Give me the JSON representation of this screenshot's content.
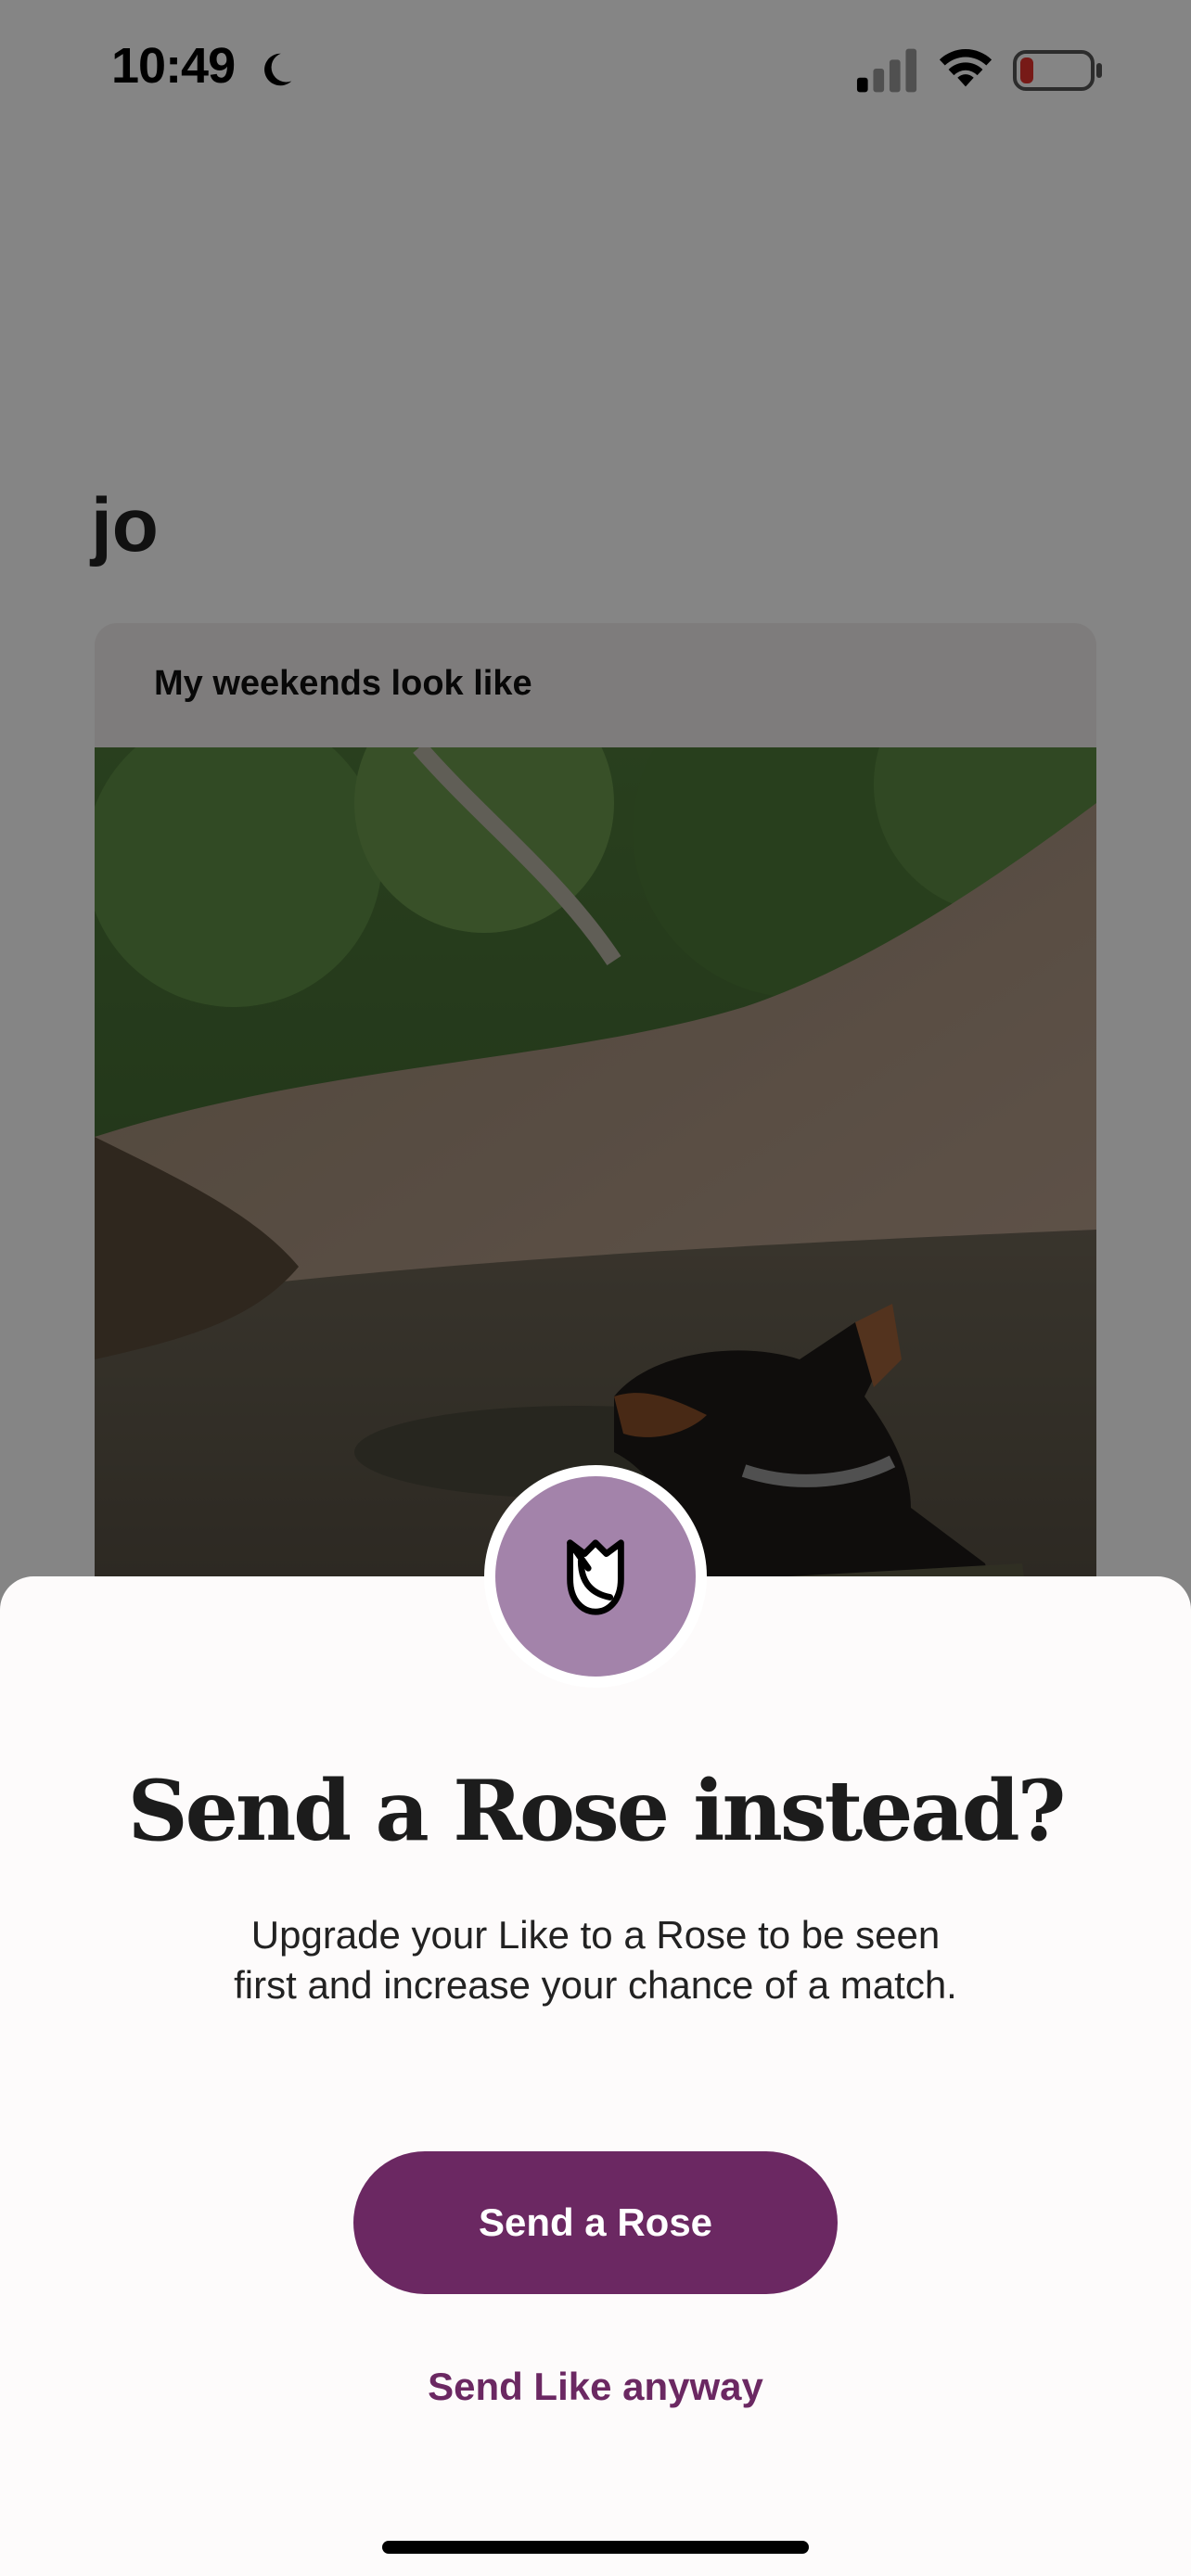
{
  "status_bar": {
    "time": "10:49",
    "icons": [
      "moon-icon",
      "cellular-signal-icon",
      "wifi-icon",
      "battery-icon"
    ],
    "battery_color": "#e5322d"
  },
  "profile": {
    "name": "jo",
    "prompt": {
      "title": "My weekends look like",
      "photo_icon": "dog-hiking-photo"
    }
  },
  "sheet": {
    "icon": "rose-icon",
    "badge_color": "#a383aa",
    "title": "Send a Rose instead?",
    "body": "Upgrade your Like to a Rose to be seen first and increase your chance of a match.",
    "primary_button": "Send a Rose",
    "secondary_link": "Send Like anyway",
    "accent_color": "#6b2862"
  }
}
